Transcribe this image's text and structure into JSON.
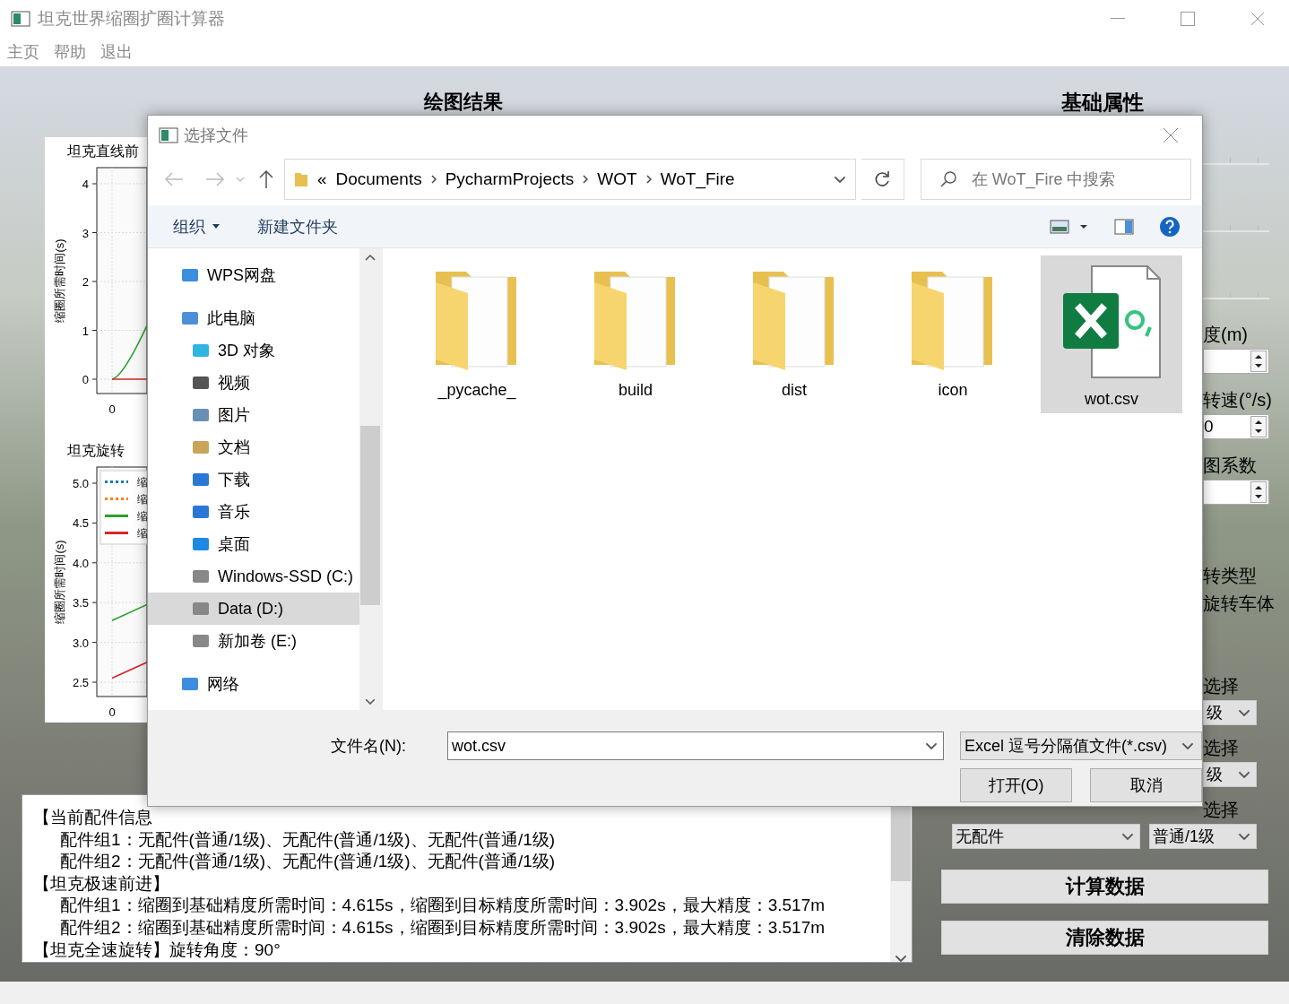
{
  "window": {
    "title": "坦克世界缩圈扩圈计算器"
  },
  "menu": [
    {
      "label": "主页",
      "disabled": true
    },
    {
      "label": "帮助",
      "disabled": true
    },
    {
      "label": "退出",
      "disabled": true
    }
  ],
  "plot_title": "绘图结果",
  "charts": [
    {
      "title": "坦克直线前",
      "ylabel": "缩圈所需时间(s)",
      "y_tick_labels": [
        "4",
        "3",
        "2",
        "1",
        "0"
      ],
      "x_tick_labels": [
        "0"
      ]
    },
    {
      "title": "坦克旋转",
      "ylabel": "缩圈所需时间(s)",
      "y_tick_labels": [
        "5.0",
        "4.5",
        "4.0",
        "3.5",
        "3.0",
        "2.5"
      ],
      "x_tick_labels": [
        "0"
      ],
      "legend": [
        {
          "name": "缩",
          "color": "#1f77b4",
          "kind": "dotted"
        },
        {
          "name": "缩",
          "color": "#ff7f0e",
          "kind": "dotted"
        },
        {
          "name": "缩",
          "color": "#2ca02c",
          "kind": "solid"
        },
        {
          "name": "缩",
          "color": "#d62728",
          "kind": "solid"
        }
      ]
    }
  ],
  "log": [
    {
      "kind": "heading",
      "text": "【当前配件信息"
    },
    {
      "kind": "line",
      "text": "配件组1：无配件(普通/1级)、无配件(普通/1级)、无配件(普通/1级)"
    },
    {
      "kind": "line",
      "text": "配件组2：无配件(普通/1级)、无配件(普通/1级)、无配件(普通/1级)"
    },
    {
      "kind": "heading",
      "text": "【坦克极速前进】"
    },
    {
      "kind": "line",
      "text": "配件组1：缩圈到基础精度所需时间：4.615s，缩圈到目标精度所需时间：3.902s，最大精度：3.517m"
    },
    {
      "kind": "line",
      "text": "配件组2：缩圈到基础精度所需时间：4.615s，缩圈到目标精度所需时间：3.902s，最大精度：3.517m"
    },
    {
      "kind": "heading",
      "text": "【坦克全速旋转】旋转角度：90°"
    }
  ],
  "right_panel": {
    "title": "基础属性",
    "rows": [
      {
        "kind": "label",
        "text": "度(m)"
      },
      {
        "kind": "spin"
      },
      {
        "kind": "label",
        "text": "转速(°/s)"
      },
      {
        "kind": "spin",
        "value": "0"
      },
      {
        "kind": "label",
        "text": "图系数"
      },
      {
        "kind": "spin"
      },
      {
        "kind": "label",
        "text": "转类型"
      },
      {
        "kind": "label",
        "text": "旋转车体"
      },
      {
        "kind": "label",
        "text": "选择"
      },
      {
        "kind": "combo",
        "value": "级"
      },
      {
        "kind": "label",
        "text": "选择"
      },
      {
        "kind": "combo",
        "value": "级"
      },
      {
        "kind": "label",
        "text": "选择"
      }
    ],
    "combos": [
      "无配件",
      "普通/1级"
    ],
    "buttons": [
      "计算数据",
      "清除数据"
    ]
  },
  "dialog": {
    "title": "选择文件",
    "path": [
      "Documents",
      "PycharmProjects",
      "WOT",
      "WoT_Fire"
    ],
    "path_prefix": "«",
    "search": {
      "placeholder": "在 WoT_Fire 中搜索"
    },
    "toolbar": [
      {
        "label": "组织",
        "dropdown": true
      },
      {
        "label": "新建文件夹",
        "dropdown": false
      }
    ],
    "nav": [
      {
        "label": "WPS网盘",
        "selected": false
      },
      {
        "label": "此电脑",
        "selected": false,
        "children": [
          {
            "label": "3D 对象",
            "selected": false
          },
          {
            "label": "视频",
            "selected": false
          },
          {
            "label": "图片",
            "selected": false
          },
          {
            "label": "文档",
            "selected": false
          },
          {
            "label": "下载",
            "selected": false
          },
          {
            "label": "音乐",
            "selected": false
          },
          {
            "label": "桌面",
            "selected": false
          },
          {
            "label": "Windows-SSD (C:)",
            "selected": false
          },
          {
            "label": "Data (D:)",
            "selected": true
          },
          {
            "label": "新加卷 (E:)",
            "selected": false
          }
        ]
      },
      {
        "label": "网络",
        "selected": false
      }
    ],
    "files": [
      {
        "name": "_pycache_",
        "kind": "folder",
        "selected": false
      },
      {
        "name": "build",
        "kind": "folder",
        "selected": false
      },
      {
        "name": "dist",
        "kind": "folder",
        "selected": false
      },
      {
        "name": "icon",
        "kind": "folder",
        "selected": false
      },
      {
        "name": "wot.csv",
        "kind": "spreadsheet",
        "selected": true
      }
    ],
    "filename_label": "文件名(N):",
    "filename": "wot.csv",
    "filter": "Excel 逗号分隔值文件(*.csv)",
    "buttons": [
      "打开(O)",
      "取消"
    ]
  }
}
